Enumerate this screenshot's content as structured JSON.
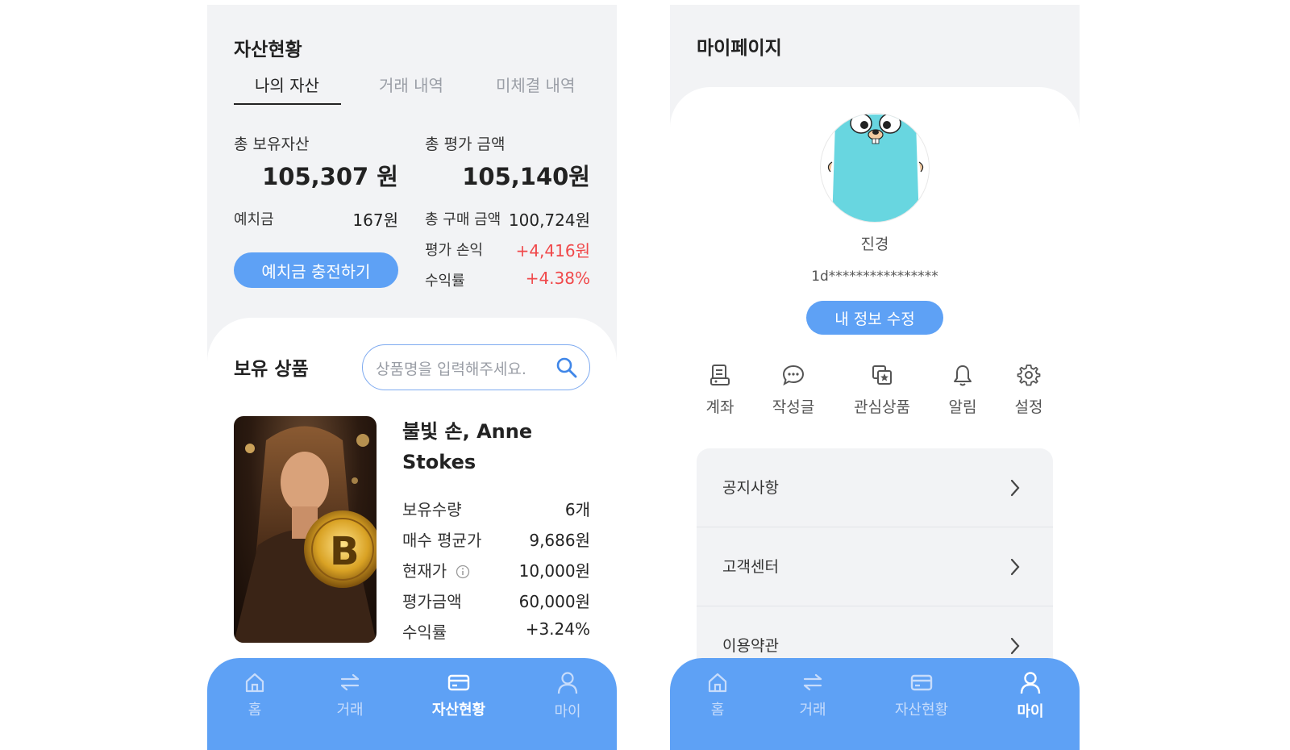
{
  "left": {
    "title": "자산현황",
    "tabs": [
      "나의 자산",
      "거래 내역",
      "미체결 내역"
    ],
    "summary": {
      "total_assets_label": "총 보유자산",
      "total_assets_value": "105,307 원",
      "total_eval_label": "총 평가 금액",
      "total_eval_value": "105,140원",
      "deposit_label": "예치금",
      "deposit_value": "167원",
      "total_purchase_label": "총 구매 금액",
      "total_purchase_value": "100,724원",
      "eval_pl_label": "평가 손익",
      "eval_pl_value": "+4,416원",
      "return_label": "수익률",
      "return_value": "+4.38%",
      "charge_button": "예치금 충전하기"
    },
    "holdings": {
      "title": "보유 상품",
      "search_placeholder": "상품명을 입력해주세요.",
      "product": {
        "name": "불빛 손, Anne Stokes",
        "rows": [
          {
            "label": "보유수량",
            "value": "6개"
          },
          {
            "label": "매수 평균가",
            "value": "9,686원"
          },
          {
            "label": "현재가",
            "value": "10,000원"
          },
          {
            "label": "평가금액",
            "value": "60,000원"
          },
          {
            "label": "수익률",
            "value": "+3.24%"
          }
        ]
      }
    }
  },
  "right": {
    "title": "마이페이지",
    "user_name": "진경",
    "user_id": "1d****************",
    "edit_button": "내 정보 수정",
    "quick_menu": [
      "계좌",
      "작성글",
      "관심상품",
      "알림",
      "설정"
    ],
    "menu": [
      "공지사항",
      "고객센터",
      "이용약관"
    ]
  },
  "nav": {
    "items": [
      "홈",
      "거래",
      "자산현황",
      "마이"
    ]
  },
  "colors": {
    "accent": "#5ea1f5",
    "profit": "#f0484a",
    "background": "#f2f3f5"
  }
}
